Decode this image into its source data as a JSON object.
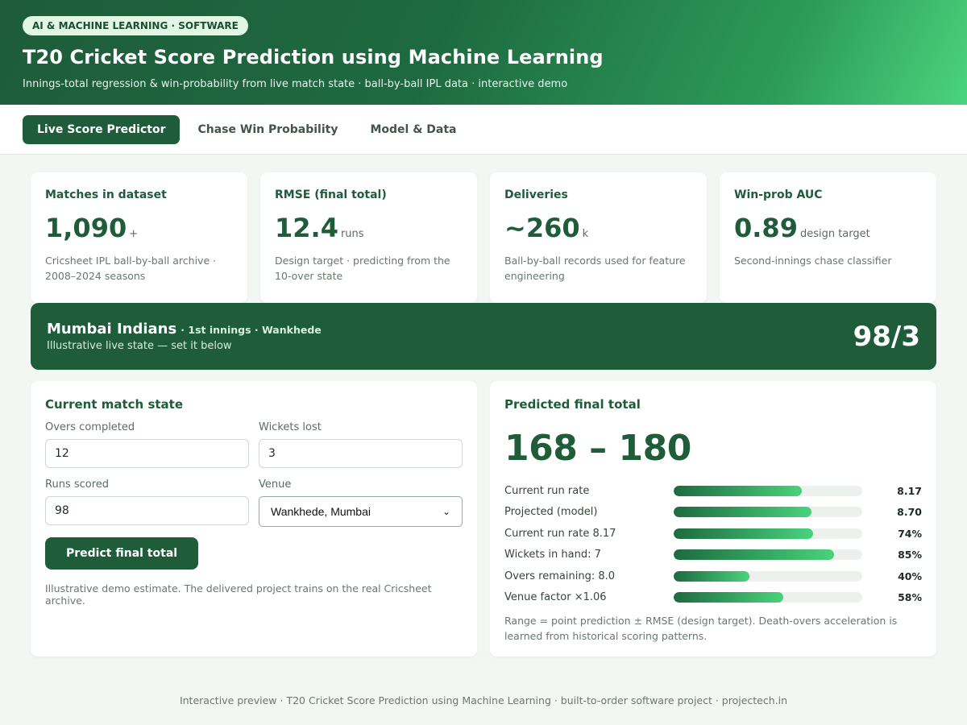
{
  "hero": {
    "badge": "AI & MACHINE LEARNING · SOFTWARE",
    "title": "T20 Cricket Score Prediction using Machine Learning",
    "subtitle": "Innings-total regression & win-probability from live match state · ball-by-ball IPL data · interactive demo"
  },
  "tabs": [
    "Live Score Predictor",
    "Chase Win Probability",
    "Model & Data"
  ],
  "stats": [
    {
      "title": "Matches in dataset",
      "value": "1,090",
      "unit": "+",
      "desc": "Cricsheet IPL ball-by-ball archive · 2008–2024 seasons"
    },
    {
      "title": "RMSE (final total)",
      "value": "12.4",
      "unit": "runs",
      "desc": "Design target · predicting from the 10-over state"
    },
    {
      "title": "Deliveries",
      "value": "~260",
      "unit": "k",
      "desc": "Ball-by-ball records used for feature engineering"
    },
    {
      "title": "Win-prob AUC",
      "value": "0.89",
      "unit": "design target",
      "desc": "Second-innings chase classifier"
    }
  ],
  "banner": {
    "team": "Mumbai Indians",
    "innings": "· 1st innings · Wankhede",
    "sub": "Illustrative live state — set it below",
    "score": "98/3"
  },
  "form": {
    "title": "Current match state",
    "overs_label": "Overs completed",
    "overs_value": "12",
    "wickets_label": "Wickets lost",
    "wickets_value": "3",
    "runs_label": "Runs scored",
    "runs_value": "98",
    "venue_label": "Venue",
    "venue_value": "Wankhede, Mumbai",
    "button": "Predict final total",
    "note": "Illustrative demo estimate. The delivered project trains on the real Cricsheet archive."
  },
  "prediction": {
    "title": "Predicted final total",
    "range": "168 – 180",
    "bars": [
      {
        "label": "Current run rate",
        "value": "8.17",
        "fill": 0.68
      },
      {
        "label": "Projected (model)",
        "value": "8.70",
        "fill": 0.73
      },
      {
        "label": "Current run rate 8.17",
        "value": "74%",
        "fill": 0.74
      },
      {
        "label": "Wickets in hand: 7",
        "value": "85%",
        "fill": 0.85
      },
      {
        "label": "Overs remaining: 8.0",
        "value": "40%",
        "fill": 0.4
      },
      {
        "label": "Venue factor ×1.06",
        "value": "58%",
        "fill": 0.58
      }
    ],
    "note": "Range = point prediction ± RMSE (design target). Death-overs acceleration is learned from historical scoring patterns."
  },
  "footer": "Interactive preview · T20 Cricket Score Prediction using Machine Learning · built-to-order software project · projectech.in"
}
